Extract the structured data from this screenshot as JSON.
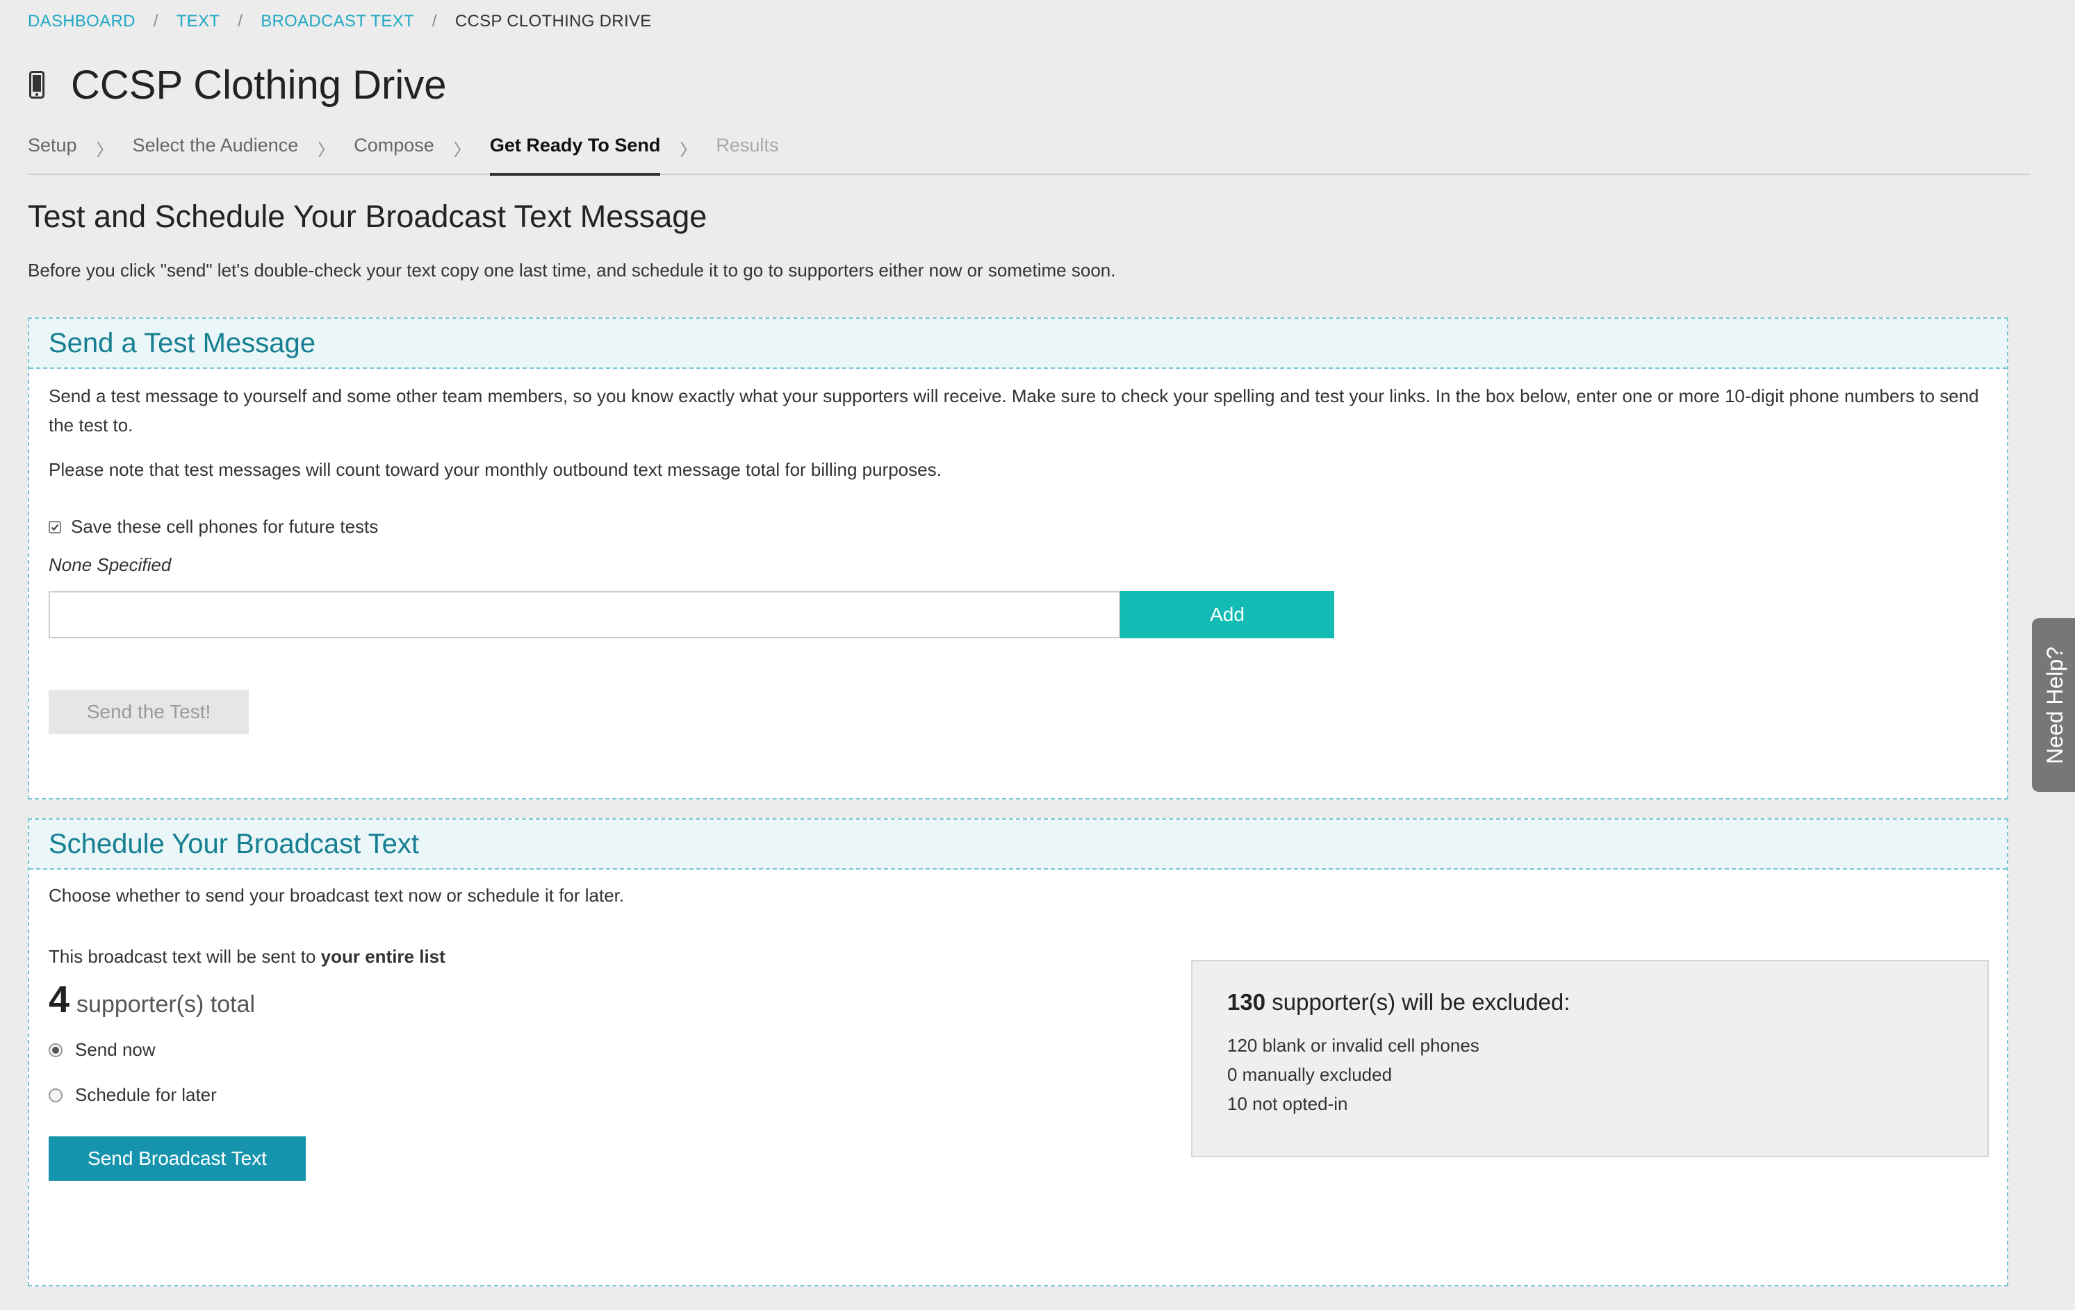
{
  "breadcrumb": {
    "items": [
      "DASHBOARD",
      "TEXT",
      "BROADCAST TEXT"
    ],
    "current": "CCSP CLOTHING DRIVE",
    "separator": "/"
  },
  "page": {
    "title": "CCSP Clothing Drive",
    "icon": "mobile-phone-icon"
  },
  "steps": {
    "setup": "Setup",
    "audience": "Select the Audience",
    "compose": "Compose",
    "ready": "Get Ready To Send",
    "results": "Results",
    "chevron": "〉"
  },
  "intro": {
    "title": "Test and Schedule Your Broadcast Text Message",
    "description": "Before you click \"send\" let's double-check your text copy one last time, and schedule it to go to supporters either now or sometime soon."
  },
  "test_panel": {
    "title": "Send a Test Message",
    "para1": "Send a test message to yourself and some other team members, so you know exactly what your supporters will receive. Make sure to check your spelling and test your links. In the box below, enter one or more 10-digit phone numbers to send the test to.",
    "para2": "Please note that test messages will count toward your monthly outbound text message total for billing purposes.",
    "save_checkbox_label": "Save these cell phones for future tests",
    "save_checked": true,
    "none_specified": "None Specified",
    "phone_input_value": "",
    "add_label": "Add",
    "send_test_label": "Send the Test!"
  },
  "schedule_panel": {
    "title": "Schedule Your Broadcast Text",
    "description": "Choose whether to send your broadcast text now or schedule it for later.",
    "sent_to_prefix": "This broadcast text will be sent to",
    "sent_to_target": "your entire list",
    "total_count": "4",
    "total_label": "supporter(s) total",
    "radio_send_now": "Send now",
    "radio_schedule": "Schedule for later",
    "selected": "send_now",
    "send_button": "Send Broadcast Text",
    "excluded": {
      "count": "130",
      "label": "supporter(s) will be excluded:",
      "lines": [
        "120 blank or invalid cell phones",
        "0 manually excluded",
        "10 not opted-in"
      ]
    }
  },
  "help_tab": {
    "label": "Need Help?"
  },
  "colors": {
    "background": "#ececec",
    "link": "#1fa8c4",
    "panel_header_bg": "#eaf6f8",
    "panel_title": "#157f91",
    "add_button": "#12bcb5",
    "send_button": "#1694ae",
    "help_tab": "#777777"
  }
}
